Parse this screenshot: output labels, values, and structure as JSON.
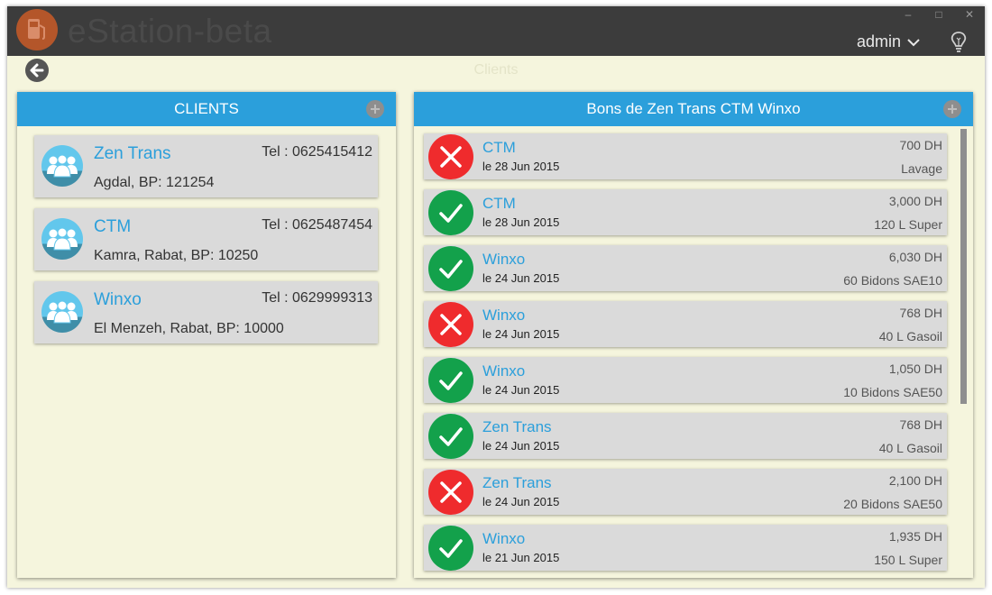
{
  "app": {
    "title": "eStation-beta",
    "user": "admin",
    "page_title": "Clients"
  },
  "colors": {
    "accent": "#2b9fdb",
    "ok": "#13a14b",
    "ko": "#ef2b2d",
    "background": "#f5f5dd"
  },
  "clients_panel": {
    "title": "CLIENTS",
    "clients": [
      {
        "name": "Zen Trans",
        "tel": "Tel : 0625415412",
        "address": "Agdal, BP: 121254"
      },
      {
        "name": "CTM",
        "tel": "Tel : 0625487454",
        "address": "Kamra, Rabat, BP: 10250"
      },
      {
        "name": "Winxo",
        "tel": "Tel : 0629999313",
        "address": "El Menzeh, Rabat, BP: 10000"
      }
    ]
  },
  "bons_panel": {
    "title": "Bons de Zen Trans CTM Winxo",
    "bons": [
      {
        "client": "CTM",
        "date": "le 28 Jun 2015",
        "amount": "700 DH",
        "product": "Lavage",
        "status": "cancelled",
        "status_icon": "x-icon"
      },
      {
        "client": "CTM",
        "date": "le 28 Jun 2015",
        "amount": "3,000 DH",
        "product": "120 L Super",
        "status": "paid",
        "status_icon": "check-icon"
      },
      {
        "client": "Winxo",
        "date": "le 24 Jun 2015",
        "amount": "6,030 DH",
        "product": "60 Bidons SAE10",
        "status": "paid",
        "status_icon": "check-icon"
      },
      {
        "client": "Winxo",
        "date": "le 24 Jun 2015",
        "amount": "768 DH",
        "product": "40 L Gasoil",
        "status": "cancelled",
        "status_icon": "x-icon"
      },
      {
        "client": "Winxo",
        "date": "le 24 Jun 2015",
        "amount": "1,050 DH",
        "product": "10 Bidons SAE50",
        "status": "paid",
        "status_icon": "check-icon"
      },
      {
        "client": "Zen Trans",
        "date": "le 24 Jun 2015",
        "amount": "768 DH",
        "product": "40 L Gasoil",
        "status": "paid",
        "status_icon": "check-icon"
      },
      {
        "client": "Zen Trans",
        "date": "le 24 Jun 2015",
        "amount": "2,100 DH",
        "product": "20 Bidons SAE50",
        "status": "cancelled",
        "status_icon": "x-icon"
      },
      {
        "client": "Winxo",
        "date": "le 21 Jun 2015",
        "amount": "1,935 DH",
        "product": "150 L Super",
        "status": "paid",
        "status_icon": "check-icon"
      }
    ]
  }
}
